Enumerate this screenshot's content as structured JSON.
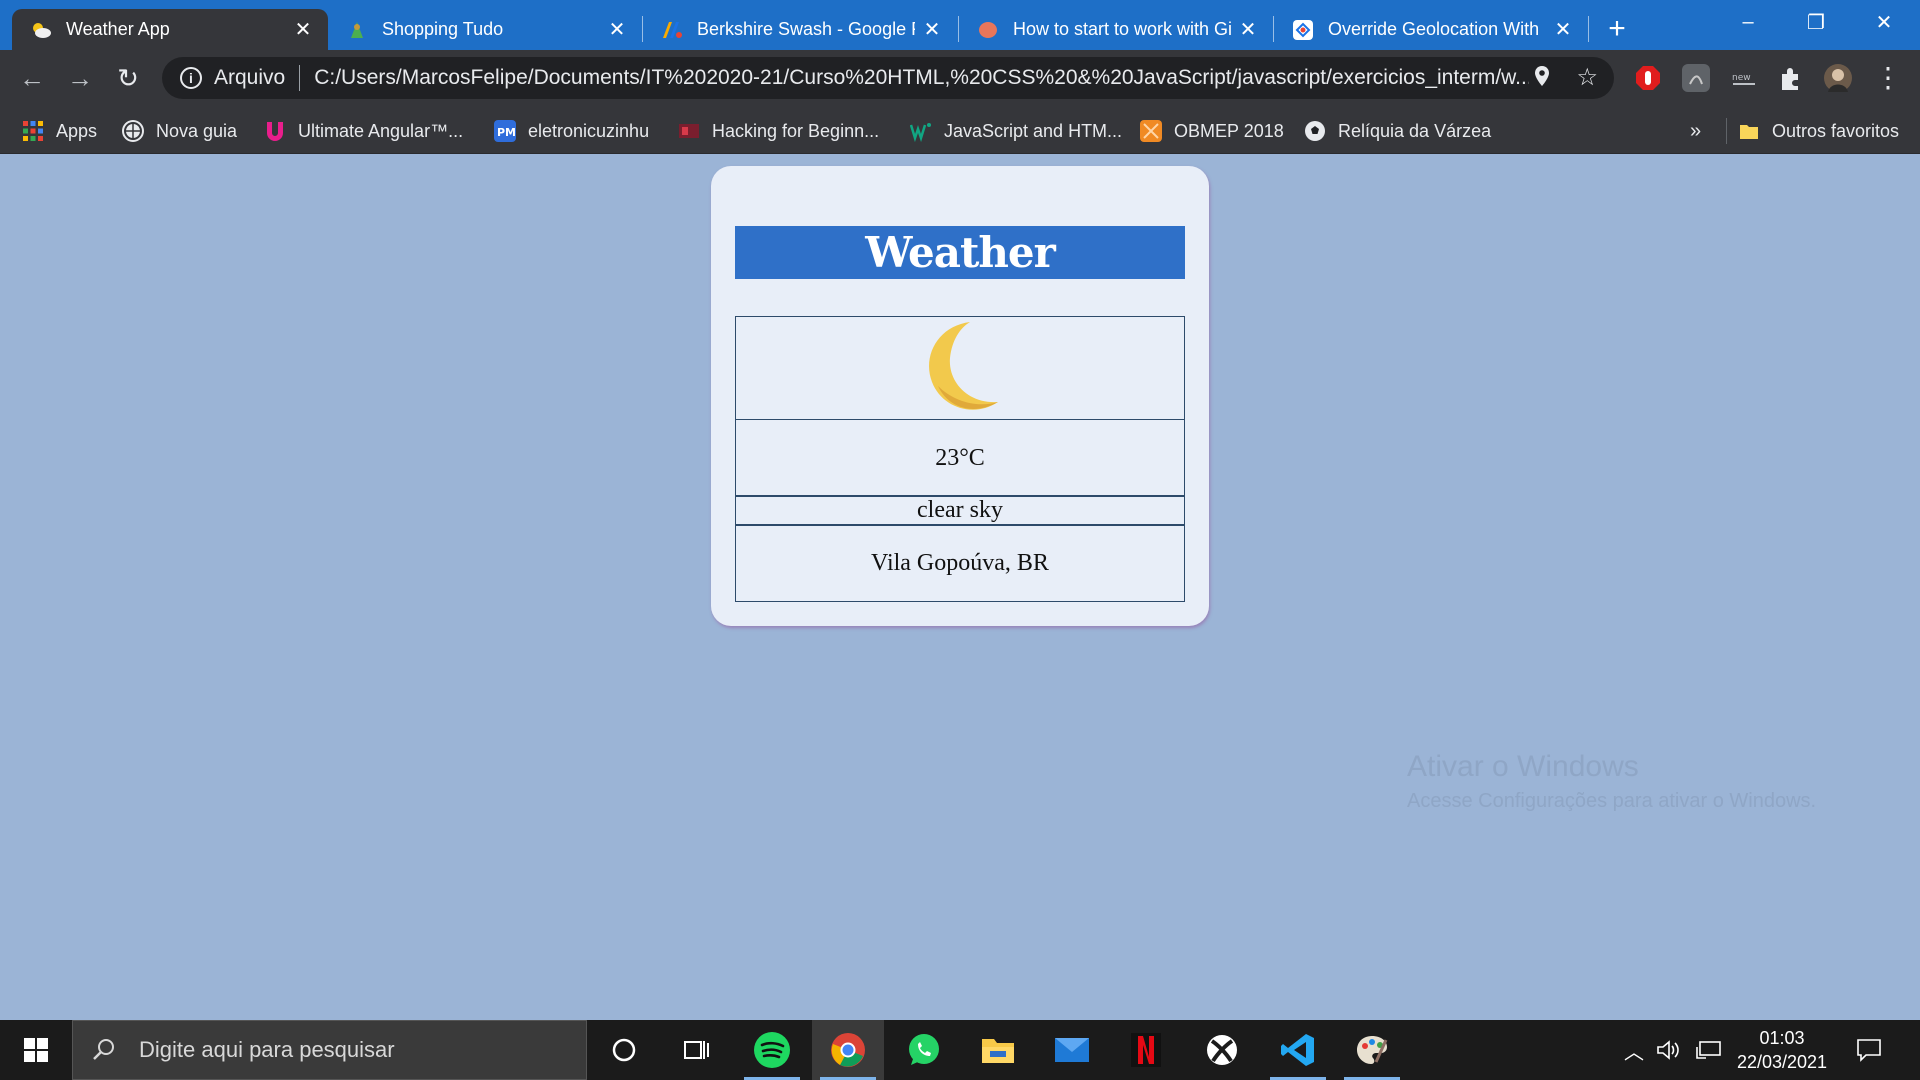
{
  "browser": {
    "tabs": [
      {
        "title": "Weather App",
        "active": true
      },
      {
        "title": "Shopping Tudo",
        "active": false
      },
      {
        "title": "Berkshire Swash - Google Fonts",
        "active": false
      },
      {
        "title": "How to start to work with Git",
        "active": false
      },
      {
        "title": "Override Geolocation With",
        "active": false
      }
    ],
    "new_tab_label": "+",
    "window_controls": {
      "minimize": "–",
      "restore": "❐",
      "close": "✕"
    }
  },
  "toolbar": {
    "scheme_label": "Arquivo",
    "url": "C:/Users/MarcosFelipe/Documents/IT%202020-21/Curso%20HTML,%20CSS%20&%20JavaScript/javascript/exercicios_interm/w..."
  },
  "bookmarks": {
    "items": [
      "Apps",
      "Nova guia",
      "Ultimate Angular™...",
      "eletronicuzinhu",
      "Hacking for Beginn...",
      "JavaScript and HTM...",
      "OBMEP 2018",
      "Relíquia da Várzea"
    ],
    "overflow_label": "»",
    "other_favorites": "Outros favoritos"
  },
  "weather": {
    "title": "Weather",
    "icon": "crescent-moon-icon",
    "temperature": "23°C",
    "description": "clear sky",
    "location": "Vila Gopoúva, BR"
  },
  "watermark": {
    "line1": "Ativar o Windows",
    "line2": "Acesse Configurações para ativar o Windows."
  },
  "taskbar": {
    "search_placeholder": "Digite aqui para pesquisar",
    "time": "01:03",
    "date": "22/03/2021"
  },
  "colors": {
    "page_bg": "#9bb4d6",
    "card_bg": "#e8eef8",
    "header_bg": "#2f70c8",
    "tab_strip": "#1e6fc7",
    "toolbar": "#35363a"
  }
}
